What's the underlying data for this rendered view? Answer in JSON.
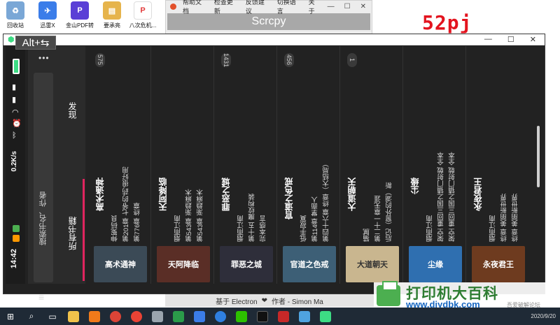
{
  "desktop": {
    "icons": [
      {
        "label": "回收站",
        "icon": "recycle-bin-icon",
        "color": "#7aa7d6"
      },
      {
        "label": "迅雷X",
        "icon": "thunder-icon",
        "color": "#3b7de9"
      },
      {
        "label": "金山PDF转",
        "icon": "pdf-icon",
        "color": "#5a3fd6"
      },
      {
        "label": "要承亮",
        "icon": "folder-icon",
        "color": "#e6b44c"
      },
      {
        "label": "八次危机...",
        "icon": "pdf-file-icon",
        "color": "#e23b3b"
      }
    ],
    "watermark": "52pj"
  },
  "scrcpy_panel": {
    "menu": [
      "帮助文档",
      "检查更新",
      "反馈建议",
      "切换语言",
      "关于"
    ],
    "title": "Scrcpy",
    "credit_prefix": "基于 Electron",
    "credit_heart": "❤",
    "credit_suffix": "作者 - Simon Ma"
  },
  "mirror": {
    "shortcut_badge": "Alt+⇆",
    "status": {
      "time": "14:42",
      "speed": "0.2K/s"
    },
    "sidebar": {
      "search_placeholder": "搜索书名、作者",
      "tab_discover": "发现",
      "tab_all_books": "所有书籍",
      "more_menu": "•••"
    },
    "books": [
      {
        "count": "575",
        "title": "高术通神",
        "author": "伸冤码良",
        "latest": "第201章 七爷的'药'很好用",
        "last": "第776章 终章",
        "cover_text": "高术通神",
        "cover_color": "#3b4a56"
      },
      {
        "count": "",
        "title": "天阿降临",
        "author": "烟雨江南",
        "latest": "第543章 渐趋麻木",
        "last": "第543章 渐趋麻木",
        "cover_text": "天阿降临",
        "cover_color": "#5a2e26"
      },
      {
        "count": "1431",
        "title": "罪恶之城",
        "author": "烟雨江南",
        "latest": "第十五 魔纹构装",
        "last": "完本感言",
        "cover_text": "罪恶之城",
        "cover_color": "#2e2e3a"
      },
      {
        "count": "456",
        "title": "官道之色戒",
        "author": "低手寂寞",
        "latest": "第114章 掌面人",
        "last": "第四十六章 终章（大结局）",
        "cover_text": "官道之色戒",
        "cover_color": "#3d5f76"
      },
      {
        "count": "1",
        "title": "大道朝天",
        "author": "猫腻",
        "latest": "第二十一章无涯",
        "last": "后记（窗外的湖）新",
        "cover_text": "大道朝天",
        "cover_color": "#c9b68f"
      },
      {
        "count": "",
        "title": "尘缘",
        "author": "烟雨江南",
        "latest": "架空 重回三国之镇门射戟 全本",
        "last": "架空 重回三国之镇门射戟 全本",
        "cover_text": "尘缘",
        "cover_color": "#2f6fb0"
      },
      {
        "count": "",
        "title": "永夜君王",
        "author": "烟雨江南",
        "latest": "终章 美丽新世界",
        "last": "终章 美丽新世界",
        "cover_text": "永夜君王",
        "cover_color": "#6e3b1f"
      }
    ]
  },
  "logo": {
    "big": "打印机大百科",
    "url": "www.djydbk.com",
    "sub": "吾爱破解论坛"
  },
  "taskbar": {
    "items": [
      "windows-icon",
      "search-icon",
      "task-view-icon",
      "file-explorer-icon",
      "search-app-icon",
      "chrome-icon",
      "app-icon",
      "security-icon",
      "edge-icon",
      "thunder-icon",
      "baidu-icon",
      "wechat-icon",
      "scrcpy-icon",
      "reader-icon",
      "paint-icon",
      "phone-icon"
    ],
    "date": "2020/9/20"
  }
}
